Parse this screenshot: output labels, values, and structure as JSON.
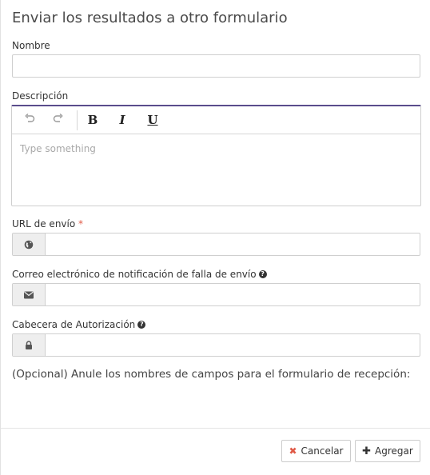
{
  "dialog": {
    "title": "Enviar los resultados a otro formulario"
  },
  "fields": {
    "nombre": {
      "label": "Nombre",
      "value": ""
    },
    "descripcion": {
      "label": "Descripción",
      "placeholder": "Type something",
      "toolbar": {
        "bold": "B",
        "italic": "I",
        "underline": "U",
        "undo_icon": "undo-icon",
        "redo_icon": "redo-icon"
      }
    },
    "url": {
      "label": "URL de envío",
      "required_mark": "*",
      "value": "",
      "icon": "globe-icon"
    },
    "email": {
      "label": "Correo electrónico de notificación de falla de envío",
      "help": "?",
      "value": "",
      "icon": "envelope-icon"
    },
    "auth": {
      "label": "Cabecera de Autorización",
      "help": "?",
      "value": "",
      "icon": "lock-icon"
    }
  },
  "note": "(Opcional) Anule los nombres de campos para el formulario de recepción:",
  "footer": {
    "cancel_label": "Cancelar",
    "add_label": "Agregar"
  },
  "colors": {
    "accent_border": "#5a4d8c",
    "required": "#e05a47"
  }
}
